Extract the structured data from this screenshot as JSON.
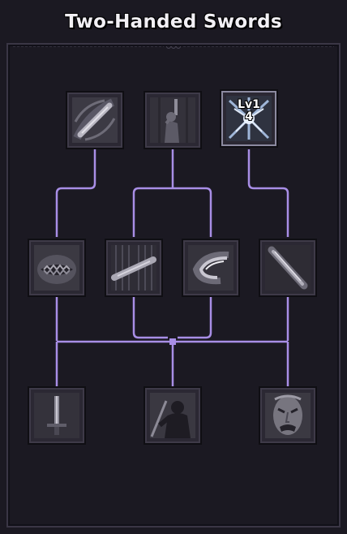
{
  "title": "Two-Handed Swords",
  "colors": {
    "background": "#1b1922",
    "connector": "#a88ee6",
    "node_bg": "#2b2833",
    "title_text": "#f2f0f5"
  },
  "skills": {
    "tier1": [
      {
        "icon": "slash-swirl-icon",
        "learned": false
      },
      {
        "icon": "raised-sword-warrior-icon",
        "learned": false
      },
      {
        "icon": "shatter-burst-icon",
        "learned": true,
        "level_prefix": "Lv1",
        "level_value": "4"
      }
    ],
    "tier2": [
      {
        "icon": "snarling-mouth-icon",
        "learned": false
      },
      {
        "icon": "sword-in-rain-icon",
        "learned": false
      },
      {
        "icon": "whirlwind-slash-icon",
        "learned": false
      },
      {
        "icon": "diagonal-blade-icon",
        "learned": false
      }
    ],
    "tier3": [
      {
        "icon": "upright-sword-icon",
        "learned": false
      },
      {
        "icon": "warrior-silhouette-icon",
        "learned": false
      },
      {
        "icon": "berserker-face-icon",
        "learned": false
      }
    ]
  }
}
